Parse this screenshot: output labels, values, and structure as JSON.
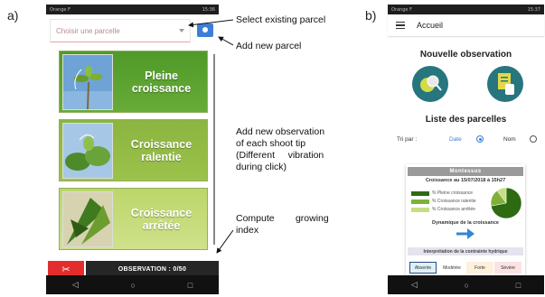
{
  "panel_labels": {
    "a": "a)",
    "b": "b)"
  },
  "phone_a": {
    "status_left": "Orange F",
    "status_right": "15:36",
    "select_placeholder": "Choisir une parcelle",
    "add_button_icon": "plus-icon",
    "categories": [
      {
        "label_line1": "Pleine",
        "label_line2": "croissance",
        "color_top": "#4f9a2a",
        "color_bottom": "#68ab37"
      },
      {
        "label_line1": "Croissance",
        "label_line2": "ralentie",
        "color_top": "#8ab540",
        "color_bottom": "#9cc24a"
      },
      {
        "label_line1": "Croissance",
        "label_line2": "arrêtée",
        "color_top": "#bcd66a",
        "color_bottom": "#cfe18a"
      }
    ],
    "observation_label": "OBSERVATION : 0/50",
    "scissors_icon": "scissors-icon"
  },
  "annotations": {
    "select_existing": "Select existing parcel",
    "add_new": "Add new parcel",
    "add_observation": [
      "Add new observation",
      "of each shoot tip",
      "(Different     vibration",
      "during click)"
    ],
    "compute_line1": "Compute        growing",
    "compute_line2": "index"
  },
  "phone_b": {
    "status_left": "Orange F",
    "status_right": "15:37",
    "title": "Accueil",
    "new_observation": "Nouvelle observation",
    "parcel_list": "Liste des parcelles",
    "sort_label": "Tri par :",
    "sort_options": [
      "Date",
      "Nom"
    ],
    "card": {
      "name": "Montessus",
      "date_line": "Croissance au 15/07/2018 à 15h27",
      "legend": [
        "% Pleine croissance",
        "% Croissance ralentie",
        "% Croissance arrêtée"
      ],
      "legend_colors": [
        "#2e6a12",
        "#7fb03a",
        "#c7dd83"
      ],
      "pie_values": [
        72,
        18,
        10
      ],
      "dynamics_label": "Dynamique de la croissance",
      "interpretation_label": "Interprétation de la contrainte hydrique",
      "chips": [
        "Absente",
        "Modérée",
        "Forte",
        "Sévère"
      ]
    }
  }
}
